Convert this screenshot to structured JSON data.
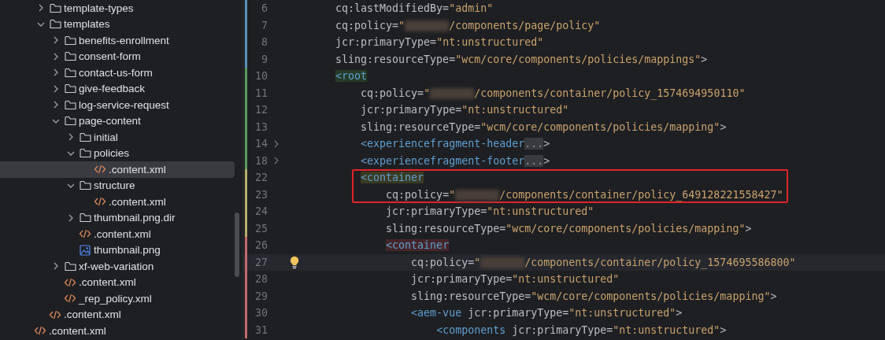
{
  "tree": {
    "items": [
      {
        "label": "template-types",
        "kind": "folder",
        "expanded": false,
        "selected": false
      },
      {
        "label": "templates",
        "kind": "folder",
        "expanded": true,
        "selected": false,
        "children": [
          {
            "label": "benefits-enrollment",
            "kind": "folder",
            "expanded": false,
            "selected": false
          },
          {
            "label": "consent-form",
            "kind": "folder",
            "expanded": false,
            "selected": false
          },
          {
            "label": "contact-us-form",
            "kind": "folder",
            "expanded": false,
            "selected": false
          },
          {
            "label": "give-feedback",
            "kind": "folder",
            "expanded": false,
            "selected": false
          },
          {
            "label": "log-service-request",
            "kind": "folder",
            "expanded": false,
            "selected": false
          },
          {
            "label": "page-content",
            "kind": "folder",
            "expanded": true,
            "selected": false,
            "children": [
              {
                "label": "initial",
                "kind": "folder",
                "expanded": false,
                "selected": false
              },
              {
                "label": "policies",
                "kind": "folder",
                "expanded": true,
                "selected": false,
                "children": [
                  {
                    "label": ".content.xml",
                    "kind": "xml",
                    "selected": true
                  }
                ]
              },
              {
                "label": "structure",
                "kind": "folder",
                "expanded": true,
                "selected": false,
                "children": [
                  {
                    "label": ".content.xml",
                    "kind": "xml",
                    "selected": false
                  }
                ]
              },
              {
                "label": "thumbnail.png.dir",
                "kind": "folder",
                "expanded": false,
                "selected": false
              },
              {
                "label": ".content.xml",
                "kind": "xml",
                "selected": false
              },
              {
                "label": "thumbnail.png",
                "kind": "image",
                "selected": false
              }
            ]
          },
          {
            "label": "xf-web-variation",
            "kind": "folder",
            "expanded": false,
            "selected": false
          },
          {
            "label": ".content.xml",
            "kind": "xml",
            "selected": false
          },
          {
            "label": "_rep_policy.xml",
            "kind": "xml",
            "selected": false
          }
        ]
      },
      {
        "label": ".content.xml",
        "kind": "xml",
        "selected": false
      }
    ],
    "outer_items": [
      {
        "label": ".content.xml",
        "kind": "xml",
        "selected": false
      }
    ]
  },
  "editor": {
    "lines": [
      {
        "number": "6",
        "marker": {
          "color": "#5a8fb8"
        },
        "tokens": [
          {
            "kind": "attr",
            "text": "cq:lastModifiedBy="
          },
          {
            "kind": "string",
            "text": "\"admin\""
          }
        ]
      },
      {
        "number": "7",
        "marker": {
          "color": "#5a8fb8"
        },
        "tokens": [
          {
            "kind": "attr",
            "text": "cq:policy="
          },
          {
            "kind": "string",
            "text": "\""
          },
          {
            "kind": "redacted"
          },
          {
            "kind": "string",
            "text": "/components/page/policy\""
          }
        ]
      },
      {
        "number": "8",
        "marker": {
          "color": "#5a8fb8"
        },
        "tokens": [
          {
            "kind": "attr",
            "text": "jcr:primaryType="
          },
          {
            "kind": "string",
            "text": "\"nt:unstructured\""
          }
        ]
      },
      {
        "number": "9",
        "marker": {
          "color": "#5a8fb8"
        },
        "tokens": [
          {
            "kind": "attr",
            "text": "sling:resourceType="
          },
          {
            "kind": "string",
            "text": "\"wcm/core/components/policies/mappings\""
          },
          {
            "kind": "punct",
            "text": ">"
          }
        ]
      },
      {
        "number": "10",
        "marker": {
          "color": "#5c9a5e"
        },
        "tokens": [
          {
            "kind": "tag",
            "text": "<root",
            "color": "#253b27"
          }
        ],
        "children": [
          {
            "number": "11",
            "marker": {
              "color": "#5c9a5e"
            },
            "tokens": [
              {
                "kind": "attr",
                "text": "cq:policy="
              },
              {
                "kind": "string",
                "text": "\""
              },
              {
                "kind": "redacted"
              },
              {
                "kind": "string",
                "text": "/components/container/policy_1574694950110\""
              }
            ]
          },
          {
            "number": "12",
            "marker": {
              "color": "#5c9a5e"
            },
            "tokens": [
              {
                "kind": "attr",
                "text": "jcr:primaryType="
              },
              {
                "kind": "string",
                "text": "\"nt:unstructured\""
              }
            ]
          },
          {
            "number": "13",
            "marker": {
              "color": "#5c9a5e"
            },
            "tokens": [
              {
                "kind": "attr",
                "text": "sling:resourceType="
              },
              {
                "kind": "string",
                "text": "\"wcm/core/components/policies/mapping\""
              },
              {
                "kind": "punct",
                "text": ">"
              }
            ]
          },
          {
            "number": "14",
            "folded": true,
            "marker": {
              "color": "#5c9a5e"
            },
            "tokens": [
              {
                "kind": "tag",
                "text": "<experiencefragment-header"
              },
              {
                "kind": "fold",
                "text": "..."
              },
              {
                "kind": "punct",
                "text": ">"
              }
            ]
          },
          {
            "number": "18",
            "folded": true,
            "marker": {
              "color": "#5c9a5e"
            },
            "tokens": [
              {
                "kind": "tag",
                "text": "<experiencefragment-footer"
              },
              {
                "kind": "fold",
                "text": "..."
              },
              {
                "kind": "punct",
                "text": ">"
              }
            ]
          },
          {
            "number": "22",
            "boxed": true,
            "marker": {
              "color": "#b5ad6c"
            },
            "tokens": [
              {
                "kind": "tag",
                "text": "<container",
                "color": "#3a3a22"
              }
            ],
            "children": [
              {
                "number": "23",
                "boxed": true,
                "marker": {
                  "color": "#b5ad6c"
                },
                "tokens": [
                  {
                    "kind": "attr",
                    "text": "cq:policy="
                  },
                  {
                    "kind": "string",
                    "text": "\""
                  },
                  {
                    "kind": "redacted"
                  },
                  {
                    "kind": "string",
                    "text": "/components/container/policy_649128221558427\""
                  }
                ]
              },
              {
                "number": "24",
                "marker": {
                  "color": "#b5ad6c"
                },
                "tokens": [
                  {
                    "kind": "attr",
                    "text": "jcr:primaryType="
                  },
                  {
                    "kind": "string",
                    "text": "\"nt:unstructured\""
                  }
                ]
              },
              {
                "number": "25",
                "marker": {
                  "color": "#b5ad6c"
                },
                "tokens": [
                  {
                    "kind": "attr",
                    "text": "sling:resourceType="
                  },
                  {
                    "kind": "string",
                    "text": "\"wcm/core/components/policies/mapping\""
                  },
                  {
                    "kind": "punct",
                    "text": ">"
                  }
                ]
              },
              {
                "number": "26",
                "marker": {
                  "color": "#c26a6e"
                },
                "tokens": [
                  {
                    "kind": "tag",
                    "text": "<container",
                    "color": "#45252a"
                  }
                ],
                "children": [
                  {
                    "number": "27",
                    "current": true,
                    "bulb": true,
                    "marker": {
                      "color": "#c26a6e"
                    },
                    "tokens": [
                      {
                        "kind": "attr",
                        "text": "cq:policy="
                      },
                      {
                        "kind": "string",
                        "text": "\""
                      },
                      {
                        "kind": "redacted"
                      },
                      {
                        "kind": "string",
                        "text": "/components/container/policy_1574695586800\""
                      }
                    ]
                  },
                  {
                    "number": "28",
                    "marker": {
                      "color": "#c26a6e"
                    },
                    "tokens": [
                      {
                        "kind": "attr",
                        "text": "jcr:primaryType="
                      },
                      {
                        "kind": "string",
                        "text": "\"nt:unstructured\""
                      }
                    ]
                  },
                  {
                    "number": "29",
                    "marker": {
                      "color": "#c26a6e"
                    },
                    "tokens": [
                      {
                        "kind": "attr",
                        "text": "sling:resourceType="
                      },
                      {
                        "kind": "string",
                        "text": "\"wcm/core/components/policies/mapping\""
                      },
                      {
                        "kind": "punct",
                        "text": ">"
                      }
                    ]
                  },
                  {
                    "number": "30",
                    "marker": {
                      "color": "#c26a6e"
                    },
                    "tokens": [
                      {
                        "kind": "tag",
                        "text": "<aem-vue"
                      },
                      {
                        "kind": "attr",
                        "text": " jcr:primaryType="
                      },
                      {
                        "kind": "string",
                        "text": "\"nt:unstructured\""
                      },
                      {
                        "kind": "punct",
                        "text": ">"
                      }
                    ],
                    "children": [
                      {
                        "number": "31",
                        "marker": {
                          "color": "#c26a6e"
                        },
                        "tokens": [
                          {
                            "kind": "tag",
                            "text": "<components"
                          },
                          {
                            "kind": "attr",
                            "text": " jcr:primaryType="
                          },
                          {
                            "kind": "string",
                            "text": "\"nt:unstructured\""
                          },
                          {
                            "kind": "punct",
                            "text": ">"
                          }
                        ]
                      }
                    ]
                  }
                ]
              }
            ]
          }
        ]
      }
    ]
  }
}
